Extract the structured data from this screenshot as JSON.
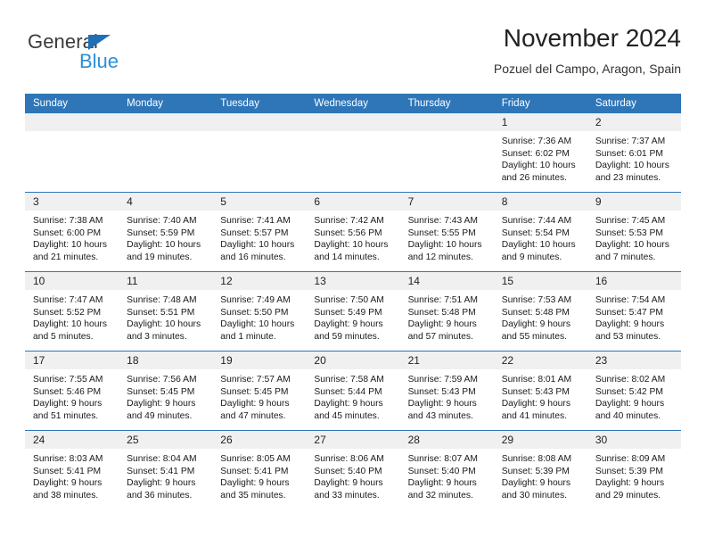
{
  "brand": {
    "name_top": "General",
    "name_bottom": "Blue",
    "triangle_color": "#1f6fb8",
    "blue_color": "#2b8fd8",
    "gray_color": "#3b3b3b"
  },
  "header": {
    "title": "November 2024",
    "subtitle": "Pozuel del Campo, Aragon, Spain"
  },
  "colors": {
    "header_row_bg": "#2e76b8",
    "header_row_text": "#ffffff",
    "daynum_bg": "#f0f0f0",
    "row_divider": "#2e76b8",
    "cell_bg": "#ffffff"
  },
  "calendar": {
    "weekdays": [
      "Sunday",
      "Monday",
      "Tuesday",
      "Wednesday",
      "Thursday",
      "Friday",
      "Saturday"
    ],
    "labels": {
      "sunrise": "Sunrise:",
      "sunset": "Sunset:",
      "daylight": "Daylight:"
    },
    "weeks": [
      [
        {
          "day": "",
          "lines": []
        },
        {
          "day": "",
          "lines": []
        },
        {
          "day": "",
          "lines": []
        },
        {
          "day": "",
          "lines": []
        },
        {
          "day": "",
          "lines": []
        },
        {
          "day": "1",
          "lines": [
            "Sunrise: 7:36 AM",
            "Sunset: 6:02 PM",
            "Daylight: 10 hours and 26 minutes."
          ]
        },
        {
          "day": "2",
          "lines": [
            "Sunrise: 7:37 AM",
            "Sunset: 6:01 PM",
            "Daylight: 10 hours and 23 minutes."
          ]
        }
      ],
      [
        {
          "day": "3",
          "lines": [
            "Sunrise: 7:38 AM",
            "Sunset: 6:00 PM",
            "Daylight: 10 hours and 21 minutes."
          ]
        },
        {
          "day": "4",
          "lines": [
            "Sunrise: 7:40 AM",
            "Sunset: 5:59 PM",
            "Daylight: 10 hours and 19 minutes."
          ]
        },
        {
          "day": "5",
          "lines": [
            "Sunrise: 7:41 AM",
            "Sunset: 5:57 PM",
            "Daylight: 10 hours and 16 minutes."
          ]
        },
        {
          "day": "6",
          "lines": [
            "Sunrise: 7:42 AM",
            "Sunset: 5:56 PM",
            "Daylight: 10 hours and 14 minutes."
          ]
        },
        {
          "day": "7",
          "lines": [
            "Sunrise: 7:43 AM",
            "Sunset: 5:55 PM",
            "Daylight: 10 hours and 12 minutes."
          ]
        },
        {
          "day": "8",
          "lines": [
            "Sunrise: 7:44 AM",
            "Sunset: 5:54 PM",
            "Daylight: 10 hours and 9 minutes."
          ]
        },
        {
          "day": "9",
          "lines": [
            "Sunrise: 7:45 AM",
            "Sunset: 5:53 PM",
            "Daylight: 10 hours and 7 minutes."
          ]
        }
      ],
      [
        {
          "day": "10",
          "lines": [
            "Sunrise: 7:47 AM",
            "Sunset: 5:52 PM",
            "Daylight: 10 hours and 5 minutes."
          ]
        },
        {
          "day": "11",
          "lines": [
            "Sunrise: 7:48 AM",
            "Sunset: 5:51 PM",
            "Daylight: 10 hours and 3 minutes."
          ]
        },
        {
          "day": "12",
          "lines": [
            "Sunrise: 7:49 AM",
            "Sunset: 5:50 PM",
            "Daylight: 10 hours and 1 minute."
          ]
        },
        {
          "day": "13",
          "lines": [
            "Sunrise: 7:50 AM",
            "Sunset: 5:49 PM",
            "Daylight: 9 hours and 59 minutes."
          ]
        },
        {
          "day": "14",
          "lines": [
            "Sunrise: 7:51 AM",
            "Sunset: 5:48 PM",
            "Daylight: 9 hours and 57 minutes."
          ]
        },
        {
          "day": "15",
          "lines": [
            "Sunrise: 7:53 AM",
            "Sunset: 5:48 PM",
            "Daylight: 9 hours and 55 minutes."
          ]
        },
        {
          "day": "16",
          "lines": [
            "Sunrise: 7:54 AM",
            "Sunset: 5:47 PM",
            "Daylight: 9 hours and 53 minutes."
          ]
        }
      ],
      [
        {
          "day": "17",
          "lines": [
            "Sunrise: 7:55 AM",
            "Sunset: 5:46 PM",
            "Daylight: 9 hours and 51 minutes."
          ]
        },
        {
          "day": "18",
          "lines": [
            "Sunrise: 7:56 AM",
            "Sunset: 5:45 PM",
            "Daylight: 9 hours and 49 minutes."
          ]
        },
        {
          "day": "19",
          "lines": [
            "Sunrise: 7:57 AM",
            "Sunset: 5:45 PM",
            "Daylight: 9 hours and 47 minutes."
          ]
        },
        {
          "day": "20",
          "lines": [
            "Sunrise: 7:58 AM",
            "Sunset: 5:44 PM",
            "Daylight: 9 hours and 45 minutes."
          ]
        },
        {
          "day": "21",
          "lines": [
            "Sunrise: 7:59 AM",
            "Sunset: 5:43 PM",
            "Daylight: 9 hours and 43 minutes."
          ]
        },
        {
          "day": "22",
          "lines": [
            "Sunrise: 8:01 AM",
            "Sunset: 5:43 PM",
            "Daylight: 9 hours and 41 minutes."
          ]
        },
        {
          "day": "23",
          "lines": [
            "Sunrise: 8:02 AM",
            "Sunset: 5:42 PM",
            "Daylight: 9 hours and 40 minutes."
          ]
        }
      ],
      [
        {
          "day": "24",
          "lines": [
            "Sunrise: 8:03 AM",
            "Sunset: 5:41 PM",
            "Daylight: 9 hours and 38 minutes."
          ]
        },
        {
          "day": "25",
          "lines": [
            "Sunrise: 8:04 AM",
            "Sunset: 5:41 PM",
            "Daylight: 9 hours and 36 minutes."
          ]
        },
        {
          "day": "26",
          "lines": [
            "Sunrise: 8:05 AM",
            "Sunset: 5:41 PM",
            "Daylight: 9 hours and 35 minutes."
          ]
        },
        {
          "day": "27",
          "lines": [
            "Sunrise: 8:06 AM",
            "Sunset: 5:40 PM",
            "Daylight: 9 hours and 33 minutes."
          ]
        },
        {
          "day": "28",
          "lines": [
            "Sunrise: 8:07 AM",
            "Sunset: 5:40 PM",
            "Daylight: 9 hours and 32 minutes."
          ]
        },
        {
          "day": "29",
          "lines": [
            "Sunrise: 8:08 AM",
            "Sunset: 5:39 PM",
            "Daylight: 9 hours and 30 minutes."
          ]
        },
        {
          "day": "30",
          "lines": [
            "Sunrise: 8:09 AM",
            "Sunset: 5:39 PM",
            "Daylight: 9 hours and 29 minutes."
          ]
        }
      ]
    ]
  }
}
